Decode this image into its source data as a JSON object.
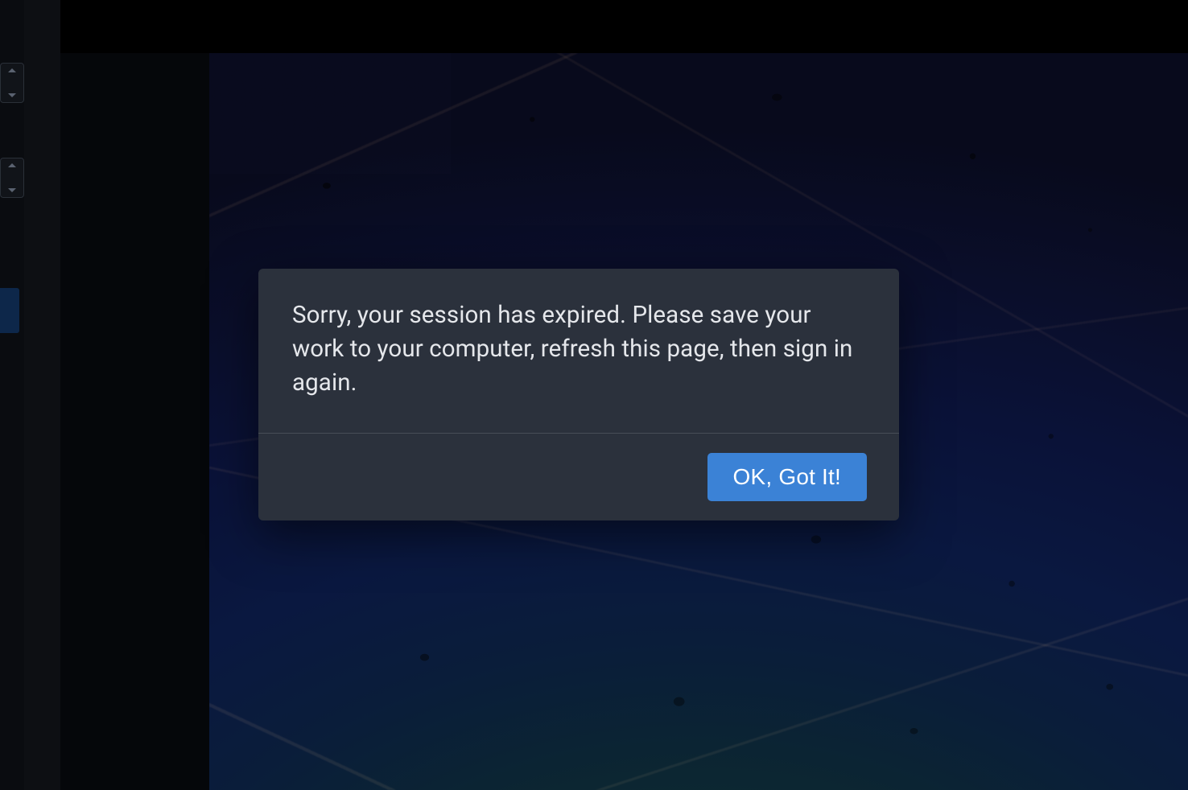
{
  "dialog": {
    "message": "Sorry, your session has expired. Please save your work to your computer, refresh this page, then sign in again.",
    "confirm_label": "OK, Got It!"
  },
  "colors": {
    "modal_bg": "#2b313c",
    "button_bg": "#3b82d6",
    "button_text": "#ffffff",
    "message_text": "#e5e7eb"
  }
}
